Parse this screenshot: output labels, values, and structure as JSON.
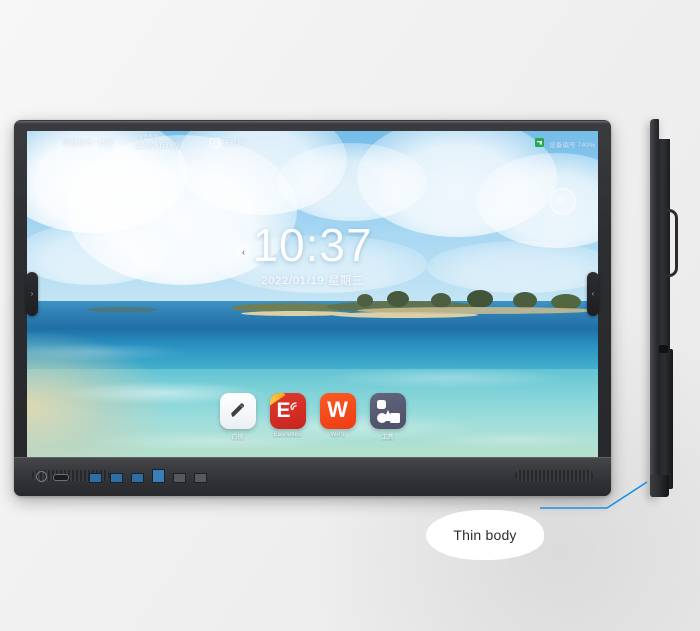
{
  "scene": {
    "background_color": "#f2f2f2",
    "product": "interactive flat panel display"
  },
  "display": {
    "bezel_color": "#2c2e31",
    "status_bar": {
      "left_text": "智慧教育一体机",
      "hotline_label": "服务热线",
      "hotline_number": "123456789",
      "network_icon": "network-box-icon",
      "network_status": "未联网",
      "right_icon": "excel-green-icon",
      "right_text": "设备编号 740%"
    },
    "floating_ball": {
      "icon": "floating-menu-ball-icon"
    },
    "clock": {
      "time": "10:37",
      "date": "2022/01/19 星期三",
      "prev_icon": "‹"
    },
    "dock": {
      "apps": [
        {
          "label": "白板",
          "icon": "note-pen-icon",
          "color": "#ffffff"
        },
        {
          "label": "EasiNote5",
          "icon": "easinote-e-icon",
          "color": "#d62c23"
        },
        {
          "label": "WPS",
          "icon": "wps-w-icon",
          "color": "#f04b1b"
        },
        {
          "label": "工具",
          "icon": "tools-shapes-icon",
          "color": "#545872"
        }
      ]
    },
    "side_buttons": {
      "left_icon": "›",
      "right_icon": "‹"
    },
    "bottom_bar": {
      "power_icon": "power-button-icon",
      "usb_c_icon": "usb-c-port-icon",
      "ports": [
        {
          "name": "usb-port-1",
          "type": "usb",
          "color": "#2e6ea8"
        },
        {
          "name": "usb-port-2",
          "type": "usb",
          "color": "#2e6ea8"
        },
        {
          "name": "usb-port-3",
          "type": "usb",
          "color": "#2e6ea8"
        },
        {
          "name": "hdmi-port",
          "type": "hdmi",
          "color": "#3a7fbb"
        },
        {
          "name": "lan-port",
          "type": "lan",
          "color": "#55585c"
        },
        {
          "name": "aux-port",
          "type": "aux",
          "color": "#55585c"
        }
      ],
      "speaker_left": "speaker-grille-left",
      "speaker_right": "speaker-grille-right"
    }
  },
  "side_view": {
    "label": "side-profile-view",
    "handle_icon": "carry-handle-icon"
  },
  "callout": {
    "text": "Thin body",
    "line_color": "#1a8fe3"
  }
}
